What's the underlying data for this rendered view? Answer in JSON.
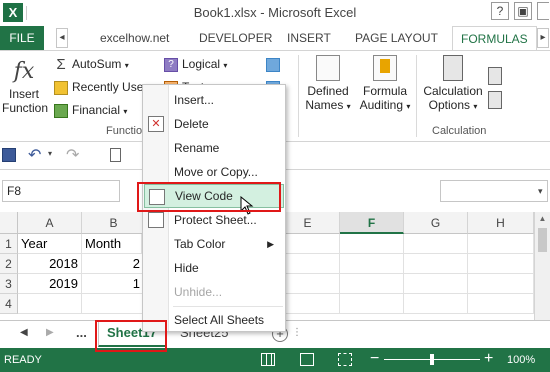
{
  "window": {
    "title": "Book1.xlsx - Microsoft Excel",
    "logo": "X"
  },
  "ribbon_tabs": {
    "file": "FILE",
    "items": [
      "excelhow.net",
      "DEVELOPER",
      "INSERT",
      "PAGE LAYOUT",
      "FORMULAS"
    ]
  },
  "ribbon": {
    "insert_function": [
      "Insert",
      "Function"
    ],
    "autosum": "AutoSum",
    "recently_used": "Recently Use",
    "financial": "Financial",
    "logical": "Logical",
    "text": "Text",
    "defined_names": [
      "Defined",
      "Names"
    ],
    "formula_auditing": [
      "Formula",
      "Auditing"
    ],
    "calc_options": [
      "Calculation",
      "Options"
    ],
    "group_function": "Functio",
    "group_calculation": "Calculation"
  },
  "formula_bar": {
    "name_box": "F8"
  },
  "grid": {
    "columns": [
      "A",
      "B",
      "E",
      "F",
      "G",
      "H"
    ],
    "selected_column": "F",
    "rows": [
      "1",
      "2",
      "3",
      "4"
    ],
    "cells": {
      "a1": "Year",
      "b1": "Month",
      "a2": "2018",
      "b2": "2",
      "a3": "2019",
      "b3": "1"
    }
  },
  "sheet_tabs": {
    "ellipsis": "...",
    "active": "Sheet17",
    "other": "Sheet25"
  },
  "context_menu": {
    "items": [
      "Insert...",
      "Delete",
      "Rename",
      "Move or Copy...",
      "View Code",
      "Protect Sheet...",
      "Tab Color",
      "Hide",
      "Unhide...",
      "Select All Sheets"
    ]
  },
  "status": {
    "ready": "READY",
    "zoom": "100%",
    "zoom_level": 100
  },
  "colors": {
    "excel_green": "#217346",
    "highlight": "#d3f0e0",
    "annotation_red": "#e01818"
  }
}
